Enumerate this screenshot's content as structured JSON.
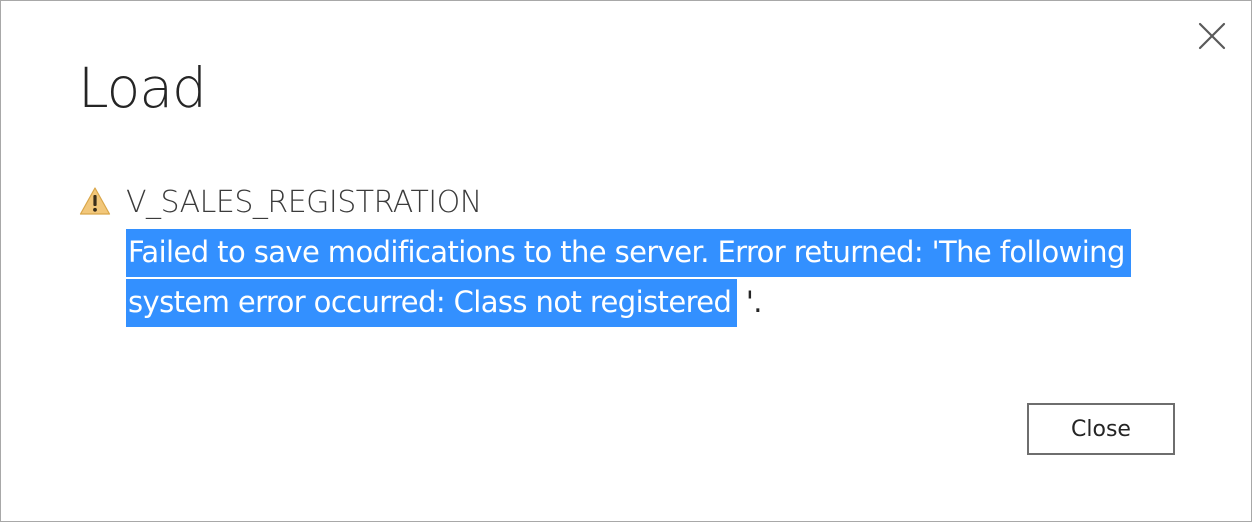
{
  "dialog": {
    "title": "Load",
    "close_icon": "close-icon",
    "close_button_label": "Close"
  },
  "error": {
    "icon": "warning-icon",
    "query_name": "V_SALES_REGISTRATION",
    "message_selected": "Failed to save modifications to the server. Error returned: 'The following system error occurred: Class not registered",
    "message_rest": " '."
  },
  "colors": {
    "selection": "#3390ff",
    "warning_fill": "#f2c77a",
    "border": "#a8a8a8"
  }
}
